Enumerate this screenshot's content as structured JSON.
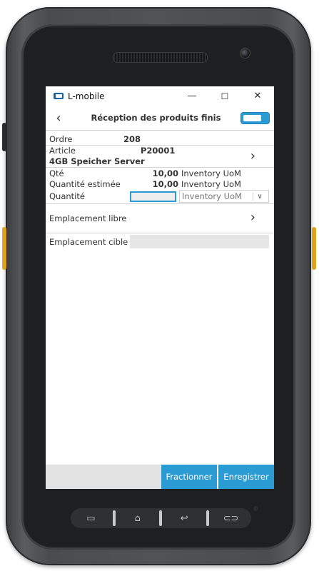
{
  "window": {
    "app_title": "L-mobile",
    "minimize": "—",
    "maximize": "☐",
    "close": "✕"
  },
  "header": {
    "back": "‹",
    "title": "Réception des produits finis"
  },
  "form": {
    "ordre_label": "Ordre",
    "ordre_value": "208",
    "article_label": "Article",
    "article_code": "P20001",
    "article_name": "4GB Speicher Server",
    "qte_label": "Qté",
    "qte_value": "10,00",
    "qte_unit": "Inventory UoM",
    "qte_estimee_label": "Quantité estimée",
    "qte_estimee_value": "10,00",
    "qte_estimee_unit": "Inventory UoM",
    "quantite_label": "Quantité",
    "quantite_value": "",
    "quantite_unit_selected": "Inventory UoM",
    "emplacement_libre_label": "Emplacement libre",
    "emplacement_cible_label": "Emplacement cible",
    "emplacement_cible_value": ""
  },
  "actions": {
    "fractionner": "Fractionner",
    "enregistrer": "Enregistrer"
  },
  "icons": {
    "chevron": "›",
    "dropdown": "∨"
  },
  "colors": {
    "accent": "#2a9bd3",
    "brand_logo": "#1565a8",
    "device_button": "#e0a21a"
  }
}
